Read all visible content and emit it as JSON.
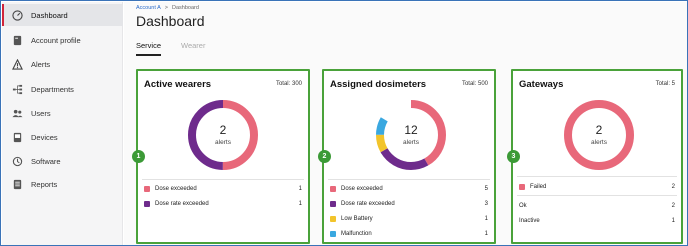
{
  "breadcrumb": {
    "account": "Account A",
    "separator": ">",
    "current": "Dashboard"
  },
  "page_title": "Dashboard",
  "tabs": [
    {
      "label": "Service"
    },
    {
      "label": "Wearer"
    }
  ],
  "sidebar": {
    "items": [
      {
        "label": "Dashboard",
        "icon": "dashboard-icon"
      },
      {
        "label": "Account profile",
        "icon": "account-profile-icon"
      },
      {
        "label": "Alerts",
        "icon": "alert-icon"
      },
      {
        "label": "Departments",
        "icon": "departments-icon"
      },
      {
        "label": "Users",
        "icon": "users-icon"
      },
      {
        "label": "Devices",
        "icon": "devices-icon"
      },
      {
        "label": "Software",
        "icon": "software-icon"
      },
      {
        "label": "Reports",
        "icon": "reports-icon"
      }
    ]
  },
  "cards": [
    {
      "badge": "1",
      "title": "Active wearers",
      "total": "Total: 300",
      "count": "2",
      "count_label": "alerts",
      "legend": [
        {
          "label": "Dose exceeded",
          "value": "1",
          "color": "#e8687a"
        },
        {
          "label": "Dose rate exceeded",
          "value": "1",
          "color": "#6e2b8c"
        }
      ]
    },
    {
      "badge": "2",
      "title": "Assigned dosimeters",
      "total": "Total: 500",
      "count": "12",
      "count_label": "alerts",
      "legend": [
        {
          "label": "Dose exceeded",
          "value": "5",
          "color": "#e8687a"
        },
        {
          "label": "Dose rate exceeded",
          "value": "3",
          "color": "#6e2b8c"
        },
        {
          "label": "Low Battery",
          "value": "1",
          "color": "#f2c42b"
        },
        {
          "label": "Malfunction",
          "value": "1",
          "color": "#3aa8e0"
        }
      ]
    },
    {
      "badge": "3",
      "title": "Gateways",
      "total": "Total: 5",
      "count": "2",
      "count_label": "alerts",
      "legend": [
        {
          "label": "Failed",
          "value": "2",
          "color": "#e8687a"
        }
      ],
      "extra": [
        {
          "label": "Ok",
          "value": "2"
        },
        {
          "label": "Inactive",
          "value": "1"
        }
      ]
    }
  ],
  "colors": {
    "card_border": "#4aa23a",
    "active_marker": "#d0243a",
    "link": "#2a6bc9"
  }
}
